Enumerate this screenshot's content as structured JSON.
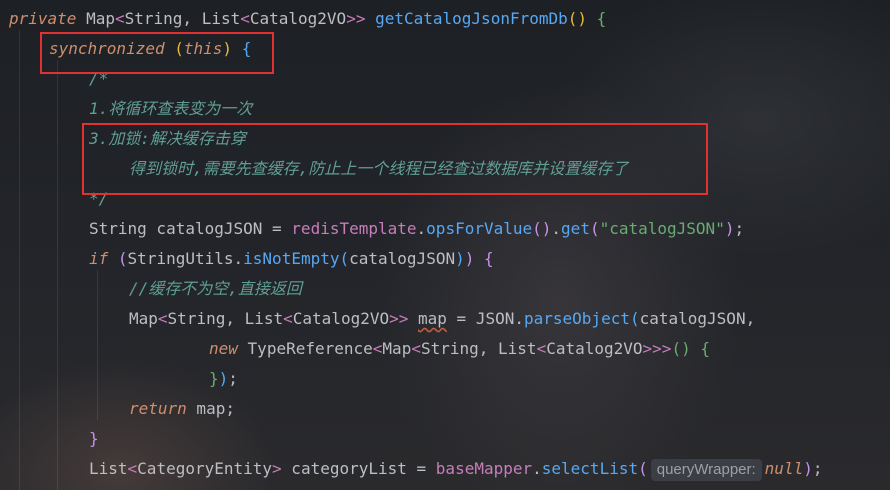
{
  "lines": [
    {
      "tokens": [
        {
          "t": "private",
          "c": "kwi"
        },
        {
          "t": " ",
          "c": "plain"
        },
        {
          "t": "Map",
          "c": "type"
        },
        {
          "t": "<",
          "c": "generic"
        },
        {
          "t": "String",
          "c": "type"
        },
        {
          "t": ", ",
          "c": "plain"
        },
        {
          "t": "List",
          "c": "type"
        },
        {
          "t": "<",
          "c": "generic"
        },
        {
          "t": "Catalog2VO",
          "c": "type"
        },
        {
          "t": ">>",
          "c": "generic"
        },
        {
          "t": " ",
          "c": "plain"
        },
        {
          "t": "getCatalogJsonFromDb",
          "c": "fn"
        },
        {
          "t": "()",
          "c": "paren-y"
        },
        {
          "t": " ",
          "c": "plain"
        },
        {
          "t": "{",
          "c": "paren-g"
        }
      ]
    },
    {
      "tokens": [
        {
          "t": "synchronized",
          "c": "kwi"
        },
        {
          "t": " ",
          "c": "plain"
        },
        {
          "t": "(",
          "c": "paren-y"
        },
        {
          "t": "this",
          "c": "kwi"
        },
        {
          "t": ")",
          "c": "paren-y"
        },
        {
          "t": " ",
          "c": "plain"
        },
        {
          "t": "{",
          "c": "paren-b"
        }
      ]
    },
    {
      "tokens": [
        {
          "t": "/*",
          "c": "doc"
        }
      ]
    },
    {
      "tokens": [
        {
          "t": "1.将循环查表变为一次",
          "c": "doc"
        }
      ]
    },
    {
      "tokens": [
        {
          "t": "3.加锁:解决缓存击穿",
          "c": "doc"
        }
      ]
    },
    {
      "tokens": [
        {
          "t": "得到锁时,需要先查缓存,防止上一个线程已经查过数据库并设置缓存了",
          "c": "doc"
        }
      ]
    },
    {
      "tokens": [
        {
          "t": "*/",
          "c": "doc"
        }
      ]
    },
    {
      "tokens": [
        {
          "t": "String",
          "c": "type"
        },
        {
          "t": " catalogJSON = ",
          "c": "plain"
        },
        {
          "t": "redisTemplate",
          "c": "field"
        },
        {
          "t": ".",
          "c": "plain"
        },
        {
          "t": "opsForValue",
          "c": "call"
        },
        {
          "t": "()",
          "c": "paren-m"
        },
        {
          "t": ".",
          "c": "plain"
        },
        {
          "t": "get",
          "c": "call"
        },
        {
          "t": "(",
          "c": "paren-m"
        },
        {
          "t": "\"catalogJSON\"",
          "c": "str"
        },
        {
          "t": ")",
          "c": "paren-m"
        },
        {
          "t": ";",
          "c": "plain"
        }
      ]
    },
    {
      "tokens": [
        {
          "t": "if",
          "c": "kwi"
        },
        {
          "t": " ",
          "c": "plain"
        },
        {
          "t": "(",
          "c": "paren-m"
        },
        {
          "t": "StringUtils",
          "c": "type"
        },
        {
          "t": ".",
          "c": "plain"
        },
        {
          "t": "isNotEmpty",
          "c": "call"
        },
        {
          "t": "(",
          "c": "paren-b"
        },
        {
          "t": "catalogJSON",
          "c": "plain"
        },
        {
          "t": ")",
          "c": "paren-b"
        },
        {
          "t": ")",
          "c": "paren-m"
        },
        {
          "t": " ",
          "c": "plain"
        },
        {
          "t": "{",
          "c": "paren-m"
        }
      ]
    },
    {
      "tokens": [
        {
          "t": "//缓存不为空,直接返回",
          "c": "doc"
        }
      ]
    },
    {
      "tokens": [
        {
          "t": "Map",
          "c": "type"
        },
        {
          "t": "<",
          "c": "generic"
        },
        {
          "t": "String",
          "c": "type"
        },
        {
          "t": ", ",
          "c": "plain"
        },
        {
          "t": "List",
          "c": "type"
        },
        {
          "t": "<",
          "c": "generic"
        },
        {
          "t": "Catalog2VO",
          "c": "type"
        },
        {
          "t": ">>",
          "c": "generic"
        },
        {
          "t": " ",
          "c": "plain"
        },
        {
          "t": "map",
          "c": "squiggle"
        },
        {
          "t": " = ",
          "c": "plain"
        },
        {
          "t": "JSON",
          "c": "type"
        },
        {
          "t": ".",
          "c": "plain"
        },
        {
          "t": "parseObject",
          "c": "call"
        },
        {
          "t": "(",
          "c": "paren-b"
        },
        {
          "t": "catalogJSON,",
          "c": "plain"
        }
      ]
    },
    {
      "tokens": [
        {
          "t": "new",
          "c": "kwi"
        },
        {
          "t": " ",
          "c": "plain"
        },
        {
          "t": "TypeReference",
          "c": "type"
        },
        {
          "t": "<",
          "c": "generic"
        },
        {
          "t": "Map",
          "c": "type"
        },
        {
          "t": "<",
          "c": "generic"
        },
        {
          "t": "String",
          "c": "type"
        },
        {
          "t": ", ",
          "c": "plain"
        },
        {
          "t": "List",
          "c": "type"
        },
        {
          "t": "<",
          "c": "generic"
        },
        {
          "t": "Catalog2VO",
          "c": "type"
        },
        {
          "t": ">>>",
          "c": "generic"
        },
        {
          "t": "()",
          "c": "paren-g"
        },
        {
          "t": " ",
          "c": "plain"
        },
        {
          "t": "{",
          "c": "paren-g"
        }
      ]
    },
    {
      "tokens": [
        {
          "t": "}",
          "c": "paren-g"
        },
        {
          "t": ")",
          "c": "paren-b"
        },
        {
          "t": ";",
          "c": "plain"
        }
      ]
    },
    {
      "tokens": [
        {
          "t": "return",
          "c": "kwi"
        },
        {
          "t": " map;",
          "c": "plain"
        }
      ]
    },
    {
      "tokens": [
        {
          "t": "}",
          "c": "paren-m"
        }
      ]
    },
    {
      "tokens": [
        {
          "t": "List",
          "c": "type"
        },
        {
          "t": "<",
          "c": "generic"
        },
        {
          "t": "CategoryEntity",
          "c": "type"
        },
        {
          "t": ">",
          "c": "generic"
        },
        {
          "t": " categoryList = ",
          "c": "plain"
        },
        {
          "t": "baseMapper",
          "c": "field"
        },
        {
          "t": ".",
          "c": "plain"
        },
        {
          "t": "selectList",
          "c": "call"
        },
        {
          "t": "(",
          "c": "paren-m"
        },
        {
          "t": "queryWrapper:",
          "c": "hint"
        },
        {
          "t": "null",
          "c": "kwi"
        },
        {
          "t": ")",
          "c": "paren-m"
        },
        {
          "t": ";",
          "c": "plain"
        }
      ]
    }
  ]
}
